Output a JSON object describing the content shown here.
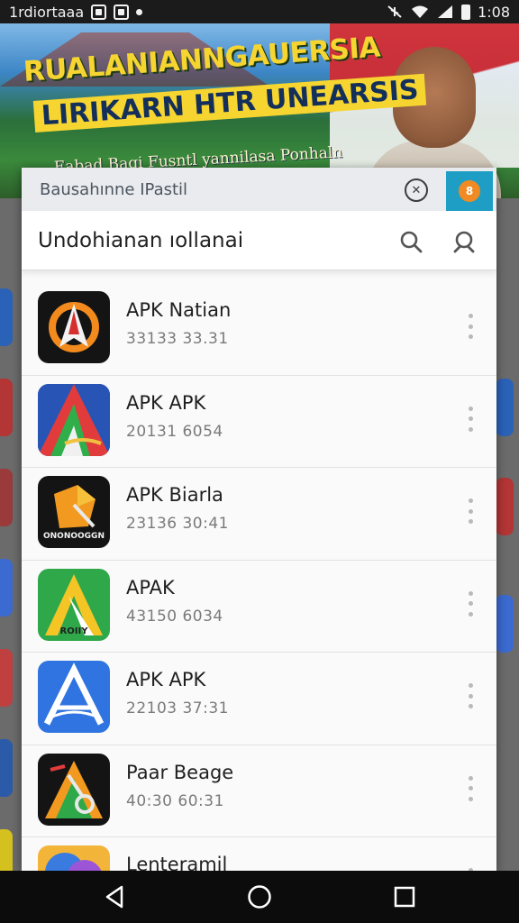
{
  "status_bar": {
    "app_label": "1rdiortaaa",
    "time": "1:08"
  },
  "banner": {
    "title_line1": "RUALANIANNGAUERSIA",
    "title_line2": "LIRIKARN HTR UNEARSIS",
    "subtitle": "Eabad Bagi Fusntl  yannilasa Ponhaln"
  },
  "sheet": {
    "top_label": "Bausahınne IPastil",
    "title": "Undohianan ıollanai"
  },
  "icons": {
    "search": "search-icon",
    "search_alt": "magnifier-icon",
    "more": "more-vert-icon",
    "back": "back-triangle-icon",
    "home": "home-circle-icon",
    "recents": "recents-square-icon"
  },
  "apps": [
    {
      "name": "APK Natian",
      "meta": "33133  33.31",
      "icon_text": ""
    },
    {
      "name": "APK APK",
      "meta": "20131  6054",
      "icon_text": ""
    },
    {
      "name": "APK Biarla",
      "meta": "23136  30:41",
      "icon_text": "ONONOOGGN"
    },
    {
      "name": "APAK",
      "meta": "43150  6034",
      "icon_text": "ROIIY"
    },
    {
      "name": "APK APK",
      "meta": "22103  37:31",
      "icon_text": ""
    },
    {
      "name": "Paar Beage",
      "meta": "40:30  60:31",
      "icon_text": ""
    },
    {
      "name": "Lenteramil",
      "meta": "",
      "icon_text": ""
    }
  ],
  "colors": {
    "accent_blue": "#1e9ec4",
    "badge_orange": "#f08a22",
    "banner_yellow": "#f6d531"
  }
}
